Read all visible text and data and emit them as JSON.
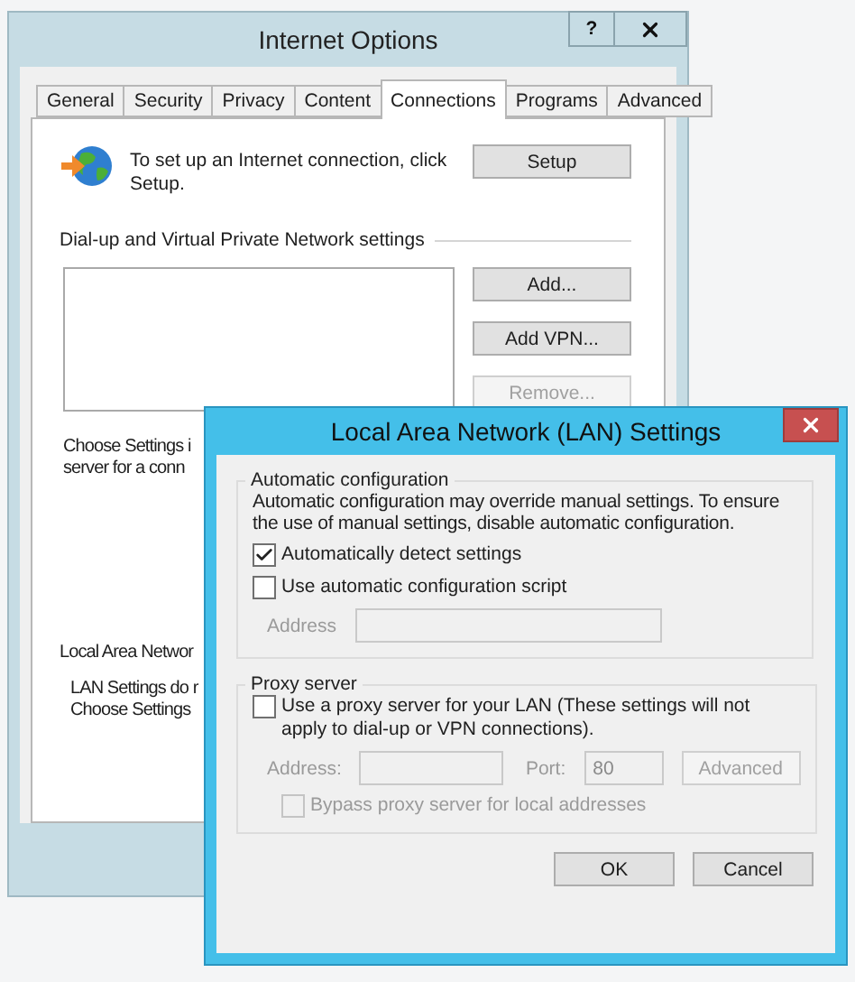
{
  "internet_options": {
    "title": "Internet Options",
    "help_button": "?",
    "tabs": [
      {
        "label": "General",
        "selected": false
      },
      {
        "label": "Security",
        "selected": false
      },
      {
        "label": "Privacy",
        "selected": false
      },
      {
        "label": "Content",
        "selected": false
      },
      {
        "label": "Connections",
        "selected": true
      },
      {
        "label": "Programs",
        "selected": false
      },
      {
        "label": "Advanced",
        "selected": false
      }
    ],
    "setup_text": "To set up an Internet connection, click Setup.",
    "setup_button": "Setup",
    "dialup_heading": "Dial-up and Virtual Private Network settings",
    "dialup_buttons": [
      {
        "label": "Add...",
        "disabled": false
      },
      {
        "label": "Add VPN...",
        "disabled": false
      },
      {
        "label": "Remove...",
        "disabled": true
      }
    ],
    "settings_text_lines": [
      "Choose Settings i",
      "server for a conn"
    ],
    "lan_heading": "Local Area Networ",
    "lan_text_lines": [
      "LAN Settings do r",
      "Choose Settings"
    ]
  },
  "lan_settings": {
    "title": "Local Area Network (LAN) Settings",
    "automatic_configuration": {
      "heading": "Automatic configuration",
      "description": "Automatic configuration may override manual settings.  To ensure the use of manual settings, disable automatic configuration.",
      "options": [
        {
          "label": "Automatically detect settings",
          "checked": true,
          "disabled": false
        },
        {
          "label": "Use automatic configuration script",
          "checked": false,
          "disabled": false
        }
      ],
      "address": {
        "label": "Address",
        "disabled": true
      }
    },
    "proxy_server": {
      "heading": "Proxy server",
      "use_proxy": {
        "label": "Use a proxy server for your LAN (These settings will not apply to dial-up or VPN connections).",
        "checked": false,
        "disabled": false
      },
      "address_label": "Address:",
      "port_label": "Port:",
      "port_value": "80",
      "advanced_button": "Advanced",
      "disabled": true,
      "bypass": {
        "label": "Bypass proxy server for local addresses",
        "checked": false,
        "disabled": true
      }
    },
    "buttons": [
      "OK",
      "Cancel"
    ]
  }
}
